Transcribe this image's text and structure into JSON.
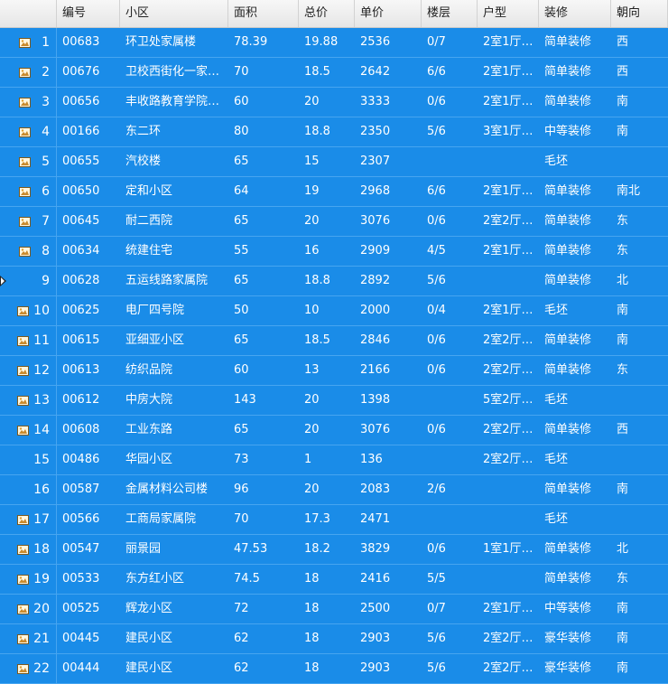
{
  "columns": [
    "编号",
    "小区",
    "面积",
    "总价",
    "单价",
    "楼层",
    "户型",
    "装修",
    "朝向"
  ],
  "rows": [
    {
      "num": "1",
      "icon": true,
      "cells": [
        "00683",
        "环卫处家属楼",
        "78.39",
        "19.88",
        "2536",
        "0/7",
        "2室1厅1…",
        "简单装修",
        "西"
      ]
    },
    {
      "num": "2",
      "icon": true,
      "cells": [
        "00676",
        "卫校西街化一家…",
        "70",
        "18.5",
        "2642",
        "6/6",
        "2室1厅1…",
        "简单装修",
        "西"
      ]
    },
    {
      "num": "3",
      "icon": true,
      "cells": [
        "00656",
        "丰收路教育学院…",
        "60",
        "20",
        "3333",
        "0/6",
        "2室1厅1…",
        "简单装修",
        "南"
      ]
    },
    {
      "num": "4",
      "icon": true,
      "cells": [
        "00166",
        "东二环",
        "80",
        "18.8",
        "2350",
        "5/6",
        "3室1厅1…",
        "中等装修",
        "南"
      ]
    },
    {
      "num": "5",
      "icon": true,
      "cells": [
        "00655",
        "汽校楼",
        "65",
        "15",
        "2307",
        "",
        "",
        "毛坯",
        ""
      ]
    },
    {
      "num": "6",
      "icon": true,
      "cells": [
        "00650",
        "定和小区",
        "64",
        "19",
        "2968",
        "6/6",
        "2室1厅1…",
        "简单装修",
        "南北"
      ]
    },
    {
      "num": "7",
      "icon": true,
      "cells": [
        "00645",
        "耐二西院",
        "65",
        "20",
        "3076",
        "0/6",
        "2室2厅1…",
        "简单装修",
        "东"
      ]
    },
    {
      "num": "8",
      "icon": true,
      "cells": [
        "00634",
        "统建住宅",
        "55",
        "16",
        "2909",
        "4/5",
        "2室1厅1…",
        "简单装修",
        "东"
      ]
    },
    {
      "num": "9",
      "icon": false,
      "marker": true,
      "cells": [
        "00628",
        "五运线路家属院",
        "65",
        "18.8",
        "2892",
        "5/6",
        "",
        "简单装修",
        "北"
      ]
    },
    {
      "num": "10",
      "icon": true,
      "cells": [
        "00625",
        "电厂四号院",
        "50",
        "10",
        "2000",
        "0/4",
        "2室1厅1…",
        "毛坯",
        "南"
      ]
    },
    {
      "num": "11",
      "icon": true,
      "cells": [
        "00615",
        "亚细亚小区",
        "65",
        "18.5",
        "2846",
        "0/6",
        "2室2厅1…",
        "简单装修",
        "南"
      ]
    },
    {
      "num": "12",
      "icon": true,
      "cells": [
        "00613",
        "纺织品院",
        "60",
        "13",
        "2166",
        "0/6",
        "2室2厅1…",
        "简单装修",
        "东"
      ]
    },
    {
      "num": "13",
      "icon": true,
      "cells": [
        "00612",
        "中房大院",
        "143",
        "20",
        "1398",
        "",
        "5室2厅2…",
        "毛坯",
        ""
      ]
    },
    {
      "num": "14",
      "icon": true,
      "cells": [
        "00608",
        "工业东路",
        "65",
        "20",
        "3076",
        "0/6",
        "2室2厅1…",
        "简单装修",
        "西"
      ]
    },
    {
      "num": "15",
      "icon": false,
      "cells": [
        "00486",
        "华园小区",
        "73",
        "1",
        "136",
        "",
        "2室2厅1…",
        "毛坯",
        ""
      ]
    },
    {
      "num": "16",
      "icon": false,
      "cells": [
        "00587",
        "金属材料公司楼",
        "96",
        "20",
        "2083",
        "2/6",
        "",
        "简单装修",
        "南"
      ]
    },
    {
      "num": "17",
      "icon": true,
      "cells": [
        "00566",
        "工商局家属院",
        "70",
        "17.3",
        "2471",
        "",
        "",
        "毛坯",
        ""
      ]
    },
    {
      "num": "18",
      "icon": true,
      "cells": [
        "00547",
        "丽景园",
        "47.53",
        "18.2",
        "3829",
        "0/6",
        "1室1厅1…",
        "简单装修",
        "北"
      ]
    },
    {
      "num": "19",
      "icon": true,
      "cells": [
        "00533",
        "东方红小区",
        "74.5",
        "18",
        "2416",
        "5/5",
        "",
        "简单装修",
        "东"
      ]
    },
    {
      "num": "20",
      "icon": true,
      "cells": [
        "00525",
        "辉龙小区",
        "72",
        "18",
        "2500",
        "0/7",
        "2室1厅1…",
        "中等装修",
        "南"
      ]
    },
    {
      "num": "21",
      "icon": true,
      "cells": [
        "00445",
        "建民小区",
        "62",
        "18",
        "2903",
        "5/6",
        "2室2厅1…",
        "豪华装修",
        "南"
      ]
    },
    {
      "num": "22",
      "icon": true,
      "cells": [
        "00444",
        "建民小区",
        "62",
        "18",
        "2903",
        "5/6",
        "2室2厅1…",
        "豪华装修",
        "南"
      ]
    }
  ],
  "colors": {
    "selection": "#1a8ce8",
    "header": "#ececec"
  }
}
